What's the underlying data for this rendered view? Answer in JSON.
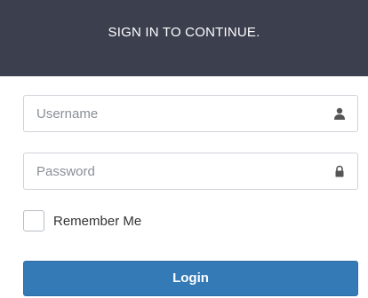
{
  "header": {
    "title": "SIGN IN TO CONTINUE."
  },
  "form": {
    "username": {
      "value": "",
      "placeholder": "Username",
      "icon": "user-icon"
    },
    "password": {
      "value": "",
      "placeholder": "Password",
      "icon": "lock-icon"
    },
    "remember": {
      "label": "Remember Me",
      "checked": false
    },
    "submit_label": "Login"
  },
  "colors": {
    "header_bg": "#3b3f4e",
    "button_bg": "#337ab7",
    "icon": "#555555"
  }
}
